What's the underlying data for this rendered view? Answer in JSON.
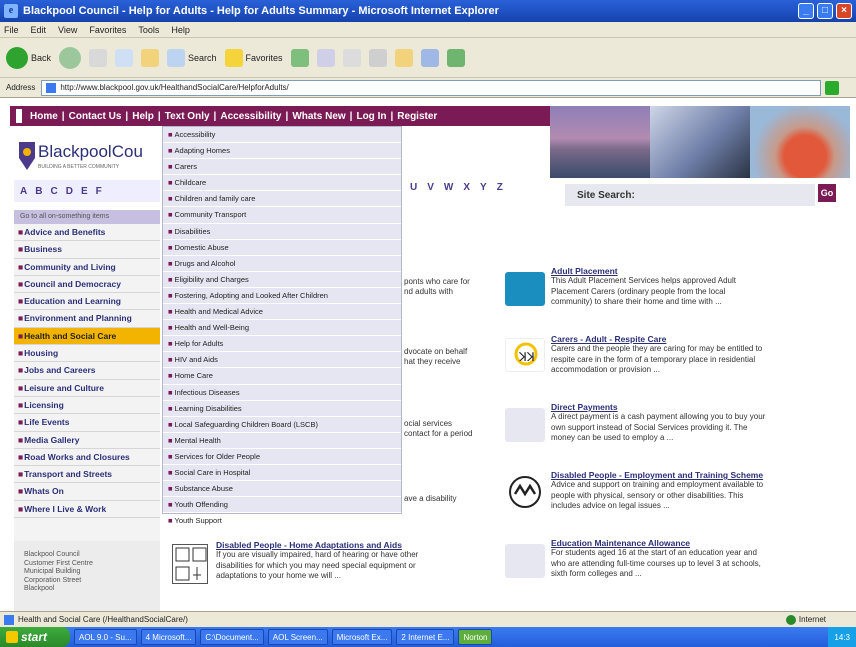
{
  "window": {
    "title": "Blackpool Council - Help for Adults - Help for Adults Summary - Microsoft Internet Explorer",
    "icon": "ie-icon",
    "buttons": [
      "minimize",
      "maximize",
      "close"
    ]
  },
  "menubar": [
    "File",
    "Edit",
    "View",
    "Favorites",
    "Tools",
    "Help"
  ],
  "toolbar": {
    "back": "Back",
    "search": "Search",
    "favorites": "Favorites"
  },
  "address": {
    "label": "Address",
    "url": "http://www.blackpool.gov.uk/HealthandSocialCare/HelpforAdults/"
  },
  "nav": [
    "Home",
    "Contact Us",
    "Help",
    "Text Only",
    "Accessibility",
    "Whats New",
    "Log In",
    "Register"
  ],
  "logo": {
    "text": "BlackpoolCou",
    "tagline": "BUILDING A BETTER COMMUNITY"
  },
  "alphabet_left": [
    "A",
    "B",
    "C",
    "D",
    "E",
    "F"
  ],
  "alphabet_right": [
    "U",
    "V",
    "W",
    "X",
    "Y",
    "Z"
  ],
  "site_search": {
    "label": "Site Search:",
    "go": "Go"
  },
  "sidebar": {
    "head": "Go to all on-something items",
    "items": [
      "Advice and Benefits",
      "Business",
      "Community and Living",
      "Council and Democracy",
      "Education and Learning",
      "Environment and Planning",
      "Health and Social Care",
      "Housing",
      "Jobs and Careers",
      "Leisure and Culture",
      "Licensing",
      "Life Events",
      "Media Gallery",
      "Road Works and Closures",
      "Transport and Streets",
      "Whats On",
      "Where I Live & Work"
    ],
    "active": "Health and Social Care"
  },
  "address_box": [
    "Blackpool Council",
    "Customer First Centre",
    "Municipal Building",
    "Corporation Street",
    "Blackpool"
  ],
  "dropdown": [
    "Accessibility",
    "Adapting Homes",
    "Carers",
    "Childcare",
    "Children and family care",
    "Community Transport",
    "Disabilities",
    "Domestic Abuse",
    "Drugs and Alcohol",
    "Eligibility and Charges",
    "Fostering, Adopting and Looked After Children",
    "Health and Medical Advice",
    "Health and Well-Being",
    "Help for Adults",
    "HIV and Aids",
    "Home Care",
    "Infectious Diseases",
    "Learning Disabilities",
    "Local Safeguarding Children Board (LSCB)",
    "Mental Health",
    "Services for Older People",
    "Social Care in Hospital",
    "Substance Abuse",
    "Youth Offending",
    "Youth Support"
  ],
  "fragments": [
    {
      "lines": [
        "ponts who care for",
        "nd adults with"
      ]
    },
    {
      "lines": [
        "dvocate on behalf",
        "hat they receive"
      ]
    },
    {
      "lines": [
        "ocial services",
        "contact for a period"
      ]
    },
    {
      "lines": [
        "ave a disability"
      ]
    }
  ],
  "cards": [
    {
      "title": "Adult Placement",
      "icon": "adult-placement-icon",
      "color": "#1a8fbf",
      "lines": [
        "This Adult Placement Services helps approved Adult",
        "Placement Carers (ordinary people from the local",
        "community) to share their home and time with ..."
      ]
    },
    {
      "title": "Carers - Adult - Respite Care",
      "icon": "carers-icon",
      "color": "#f2c200",
      "lines": [
        "Carers and the people they are caring for may be entitled to",
        "respite care in the form of a temporary place in residential",
        "accommodation or provision ..."
      ]
    },
    {
      "title": "Direct Payments",
      "icon": "direct-payments-icon",
      "color": "#e7e7f2",
      "lines": [
        "A direct payment is a cash payment allowing you to buy your",
        "own support instead of Social Services providing it. The",
        "money can be used to employ a ..."
      ]
    },
    {
      "title": "Disabled People - Employment and Training Scheme",
      "icon": "positive-disability-icon",
      "color": "#ffffff",
      "lines": [
        "Advice and support on training and employment available to",
        "people with physical, sensory or other disabilities. This",
        "includes advice on legal issues ..."
      ]
    },
    {
      "title": "Education Maintenance Allowance",
      "icon": "ema-icon",
      "color": "#e7e7f2",
      "lines": [
        "For students aged 16 at the start of an education year and",
        "who are attending full-time courses up to level 3 at schools,",
        "sixth form colleges and ..."
      ]
    }
  ],
  "bottom_card": {
    "title": "Disabled People - Home Adaptations and Aids",
    "icon": "home-adaptations-icon",
    "lines": [
      "If you are visually impaired, hard of hearing or have other",
      "disabilities for which you may need special equipment or",
      "adaptations to your home we will ..."
    ]
  },
  "status": {
    "text": "Health and Social Care (/HealthandSocialCare/)",
    "zone": "Internet"
  },
  "taskbar": {
    "start": "start",
    "tasks": [
      "AOL 9.0 - Su...",
      "4 Microsoft...",
      "C:\\Document...",
      "AOL Screen...",
      "Microsoft Ex...",
      "2 Internet E...",
      "Norton"
    ],
    "clock": "14:3"
  }
}
